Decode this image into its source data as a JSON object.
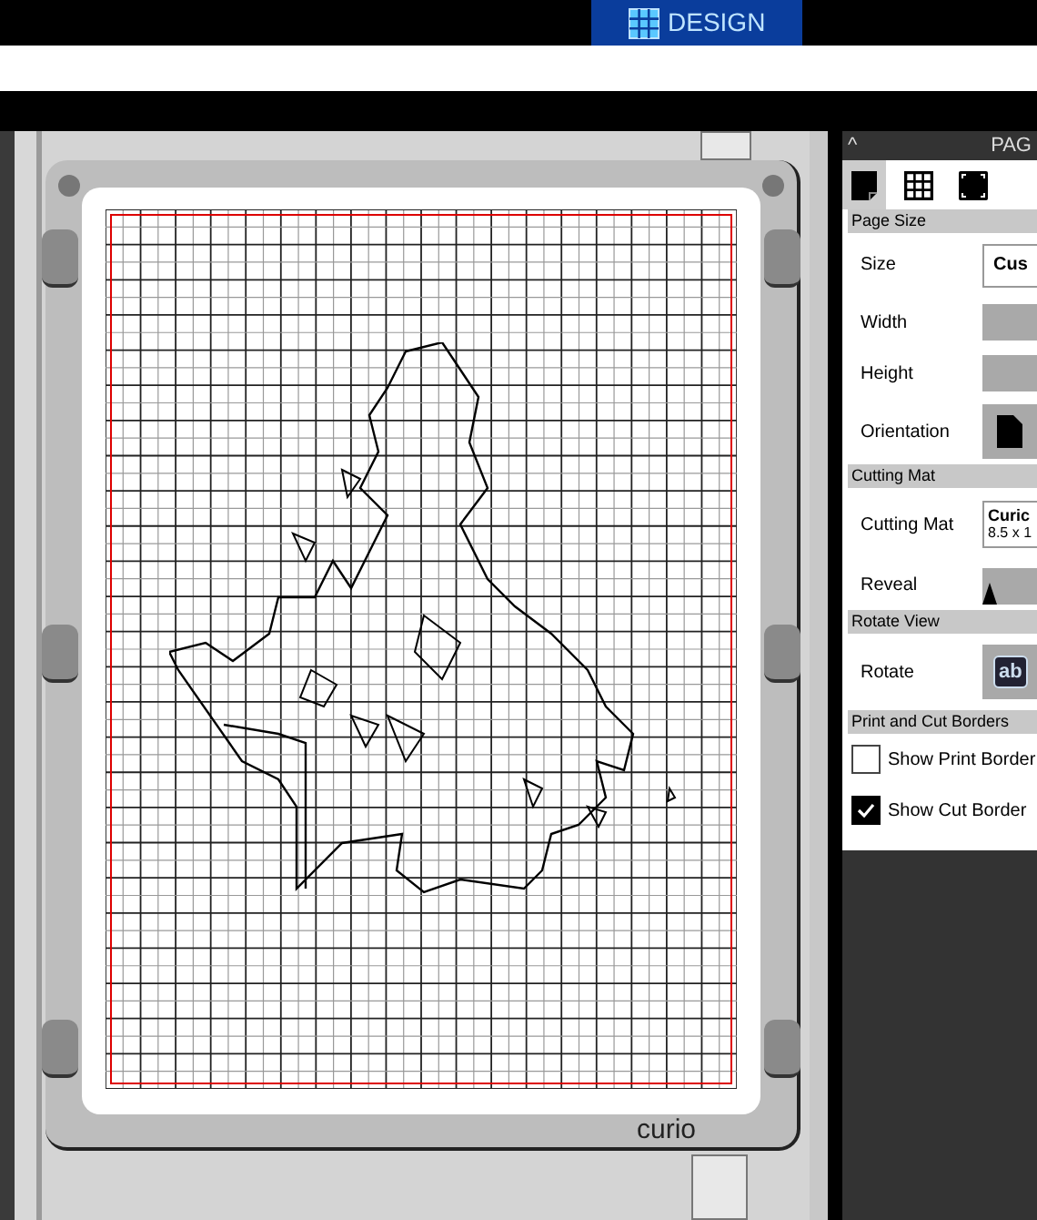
{
  "top_bar": {
    "tabs": [
      {
        "label": "DESIGN",
        "selected": true
      }
    ]
  },
  "mat": {
    "brand": "curio"
  },
  "panel": {
    "caret": "^",
    "title": "PAG",
    "view_icons": [
      {
        "kind": "page",
        "selected": true
      },
      {
        "kind": "grid",
        "selected": false
      },
      {
        "kind": "corners",
        "selected": false
      }
    ],
    "sections": [
      {
        "title": "Page Size",
        "rows": [
          {
            "kind": "field",
            "label": "Size",
            "value": "Cus"
          },
          {
            "kind": "blank",
            "label": "Width"
          },
          {
            "kind": "blank",
            "label": "Height"
          },
          {
            "kind": "page",
            "label": "Orientation"
          }
        ]
      },
      {
        "title": "Cutting Mat",
        "rows": [
          {
            "kind": "mat",
            "label": "Cutting Mat",
            "value": "Curic",
            "detail": "8.5 x 1"
          },
          {
            "kind": "slider",
            "label": "Reveal",
            "level": 0
          }
        ]
      },
      {
        "title": "Rotate View",
        "rows": [
          {
            "kind": "rotate",
            "label": "Rotate",
            "value": "ab"
          }
        ]
      },
      {
        "title": "Print and Cut Borders",
        "rows": [
          {
            "kind": "check",
            "label": "Show Print Border",
            "checked": false
          },
          {
            "kind": "check",
            "label": "Show Cut Border",
            "checked": true
          }
        ]
      }
    ]
  }
}
